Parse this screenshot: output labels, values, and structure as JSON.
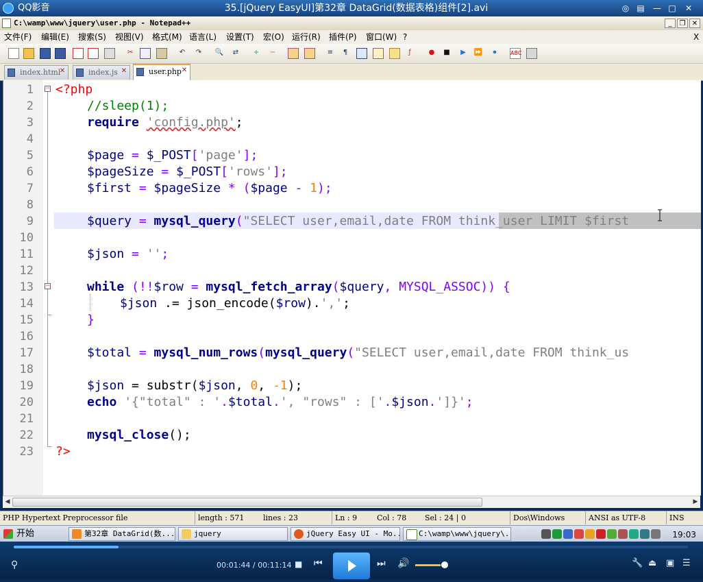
{
  "player": {
    "app_name": "QQ影音",
    "title": "35.[jQuery EasyUI]第32章 DataGrid(数据表格)组件[2].avi",
    "controls": {
      "time": "00:01:44 / 00:11:14",
      "progress": 0.155,
      "volume": 0.85
    }
  },
  "notepad": {
    "title": "C:\\wamp\\www\\jquery\\user.php - Notepad++",
    "menu": [
      "文件(F)",
      "编辑(E)",
      "搜索(S)",
      "视图(V)",
      "格式(M)",
      "语言(L)",
      "设置(T)",
      "宏(O)",
      "运行(R)",
      "插件(P)",
      "窗口(W)",
      "?"
    ],
    "menu_close": "X",
    "tabs": [
      {
        "label": "index.html",
        "active": false
      },
      {
        "label": "index.js",
        "active": false
      },
      {
        "label": "user.php",
        "active": true
      }
    ],
    "toolbar_icons": [
      "new-icon",
      "open-icon",
      "save-icon",
      "save-all-icon",
      "close-icon",
      "close-all-icon",
      "print-icon",
      "cut-icon",
      "copy-icon",
      "paste-icon",
      "undo-icon",
      "redo-icon",
      "find-icon",
      "replace-icon",
      "zoom-in-icon",
      "zoom-out-icon",
      "sync-v-icon",
      "sync-h-icon",
      "wrap-icon",
      "all-chars-icon",
      "indent-guide-icon",
      "udl-icon",
      "doc-map-icon",
      "function-list-icon",
      "record-icon",
      "stop-icon",
      "play-icon",
      "play-multi-icon",
      "save-macro-icon",
      "spellcheck-icon",
      "abc-label-icon"
    ],
    "lines": [
      {
        "n": "1"
      },
      {
        "n": "2"
      },
      {
        "n": "3"
      },
      {
        "n": "4"
      },
      {
        "n": "5"
      },
      {
        "n": "6"
      },
      {
        "n": "7"
      },
      {
        "n": "8"
      },
      {
        "n": "9"
      },
      {
        "n": "10"
      },
      {
        "n": "11"
      },
      {
        "n": "12"
      },
      {
        "n": "13"
      },
      {
        "n": "14"
      },
      {
        "n": "15"
      },
      {
        "n": "16"
      },
      {
        "n": "17"
      },
      {
        "n": "18"
      },
      {
        "n": "19"
      },
      {
        "n": "20"
      },
      {
        "n": "21"
      },
      {
        "n": "22"
      },
      {
        "n": "23"
      }
    ],
    "code": {
      "l1": {
        "t": "<?php"
      },
      "l2": {
        "t": "//sleep(1);"
      },
      "l3": {
        "kw": "require",
        "s": "'config.php'",
        "p": ";"
      },
      "l5": {
        "v": "$page",
        "p1": " = ",
        "v2": "$_POST",
        "p2": "[",
        "s": "'page'",
        "p3": "];"
      },
      "l6": {
        "v": "$pageSize",
        "p1": " = ",
        "v2": "$_POST",
        "p2": "[",
        "s": "'rows'",
        "p3": "];"
      },
      "l7": {
        "v": "$first",
        "p1": " = ",
        "v2": "$pageSize",
        "p2": " * (",
        "v3": "$page",
        "p3": " - ",
        "n": "1",
        "p4": ");"
      },
      "l9": {
        "v": "$query",
        "p1": " = ",
        "fn": "mysql_query",
        "p2": "(",
        "s": "\"SELECT user,email,date FROM think_user LIMIT $first"
      },
      "l11": {
        "v": "$json",
        "p1": " = ",
        "s": "''",
        "p2": ";"
      },
      "l13": {
        "kw": "while",
        "p1": " (!!",
        "v": "$row",
        "p2": " = ",
        "fn": "mysql_fetch_array",
        "p3": "(",
        "v2": "$query",
        "p4": ", MYSQL_ASSOC)) {"
      },
      "l14": {
        "v": "$json",
        "p1": " .= json_encode(",
        "v2": "$row",
        "p2": ").",
        "s": "','",
        "p3": ";"
      },
      "l15": {
        "t": "}"
      },
      "l17": {
        "v": "$total",
        "p1": " = ",
        "fn": "mysql_num_rows",
        "p2": "(",
        "fn2": "mysql_query",
        "p3": "(",
        "s": "\"SELECT user,email,date FROM think_us"
      },
      "l19": {
        "v": "$json",
        "p1": " = substr(",
        "v2": "$json",
        "p2": ", ",
        "n1": "0",
        "p3": ", ",
        "n2": "-1",
        "p4": ");"
      },
      "l20": {
        "kw": "echo",
        "s1": "'{\"total\" : '",
        "p1": ".",
        "v": "$total",
        "p2": ".",
        "s2": "', \"rows\" : ['",
        "p3": ".",
        "v2": "$json",
        "p4": ".",
        "s3": "']}'",
        "p5": ";"
      },
      "l22": {
        "fn": "mysql_close",
        "p": "();"
      },
      "l23": {
        "t": "?>"
      }
    },
    "status": {
      "lang": "PHP Hypertext Preprocessor file",
      "length": "length : 571",
      "lines": "lines : 23",
      "ln": "Ln : 9",
      "col": "Col : 78",
      "sel": "Sel : 24 | 0",
      "eol": "Dos\\Windows",
      "encoding": "ANSI as UTF-8",
      "mode": "INS"
    }
  },
  "taskbar": {
    "start": "开始",
    "tasks": [
      {
        "label": "第32章 DataGrid(数...",
        "icon": "qq-player-icon"
      },
      {
        "label": "jquery",
        "icon": "folder-icon"
      },
      {
        "label": "jQuery Easy UI - Mo...",
        "icon": "firefox-icon"
      },
      {
        "label": "C:\\wamp\\www\\jquery\\...",
        "icon": "notepad-icon"
      }
    ],
    "clock": "19:03"
  },
  "colors": {
    "player_blue": "#13417e",
    "accent": "#f1a33c",
    "keyword": "#00008b",
    "string": "#808080",
    "comment": "#008000",
    "number": "#ff8000"
  }
}
